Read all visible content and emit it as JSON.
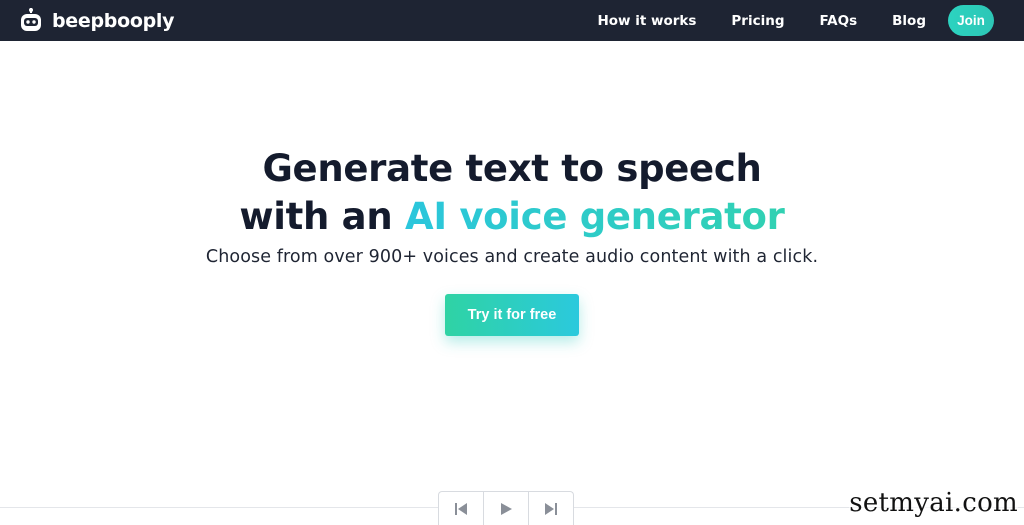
{
  "navbar": {
    "brand_name": "beepbooply",
    "links": [
      {
        "label": "How it works"
      },
      {
        "label": "Pricing"
      },
      {
        "label": "FAQs"
      },
      {
        "label": "Blog"
      }
    ],
    "join_label": "Join"
  },
  "hero": {
    "title_line1": "Generate text to speech",
    "title_line2_prefix": "with an ",
    "title_line2_accent": "AI voice generator",
    "subtitle": "Choose from over 900+ voices and create audio content with a click.",
    "cta_label": "Try it for free"
  },
  "player": {
    "icons": [
      "skip-back-icon",
      "play-icon",
      "skip-forward-icon"
    ]
  },
  "watermark": "setmyai.com",
  "colors": {
    "navbar_bg": "#1e2433",
    "accent_teal": "#2cd3c0",
    "accent_cyan": "#2bc9dd",
    "heading": "#141b2d"
  }
}
